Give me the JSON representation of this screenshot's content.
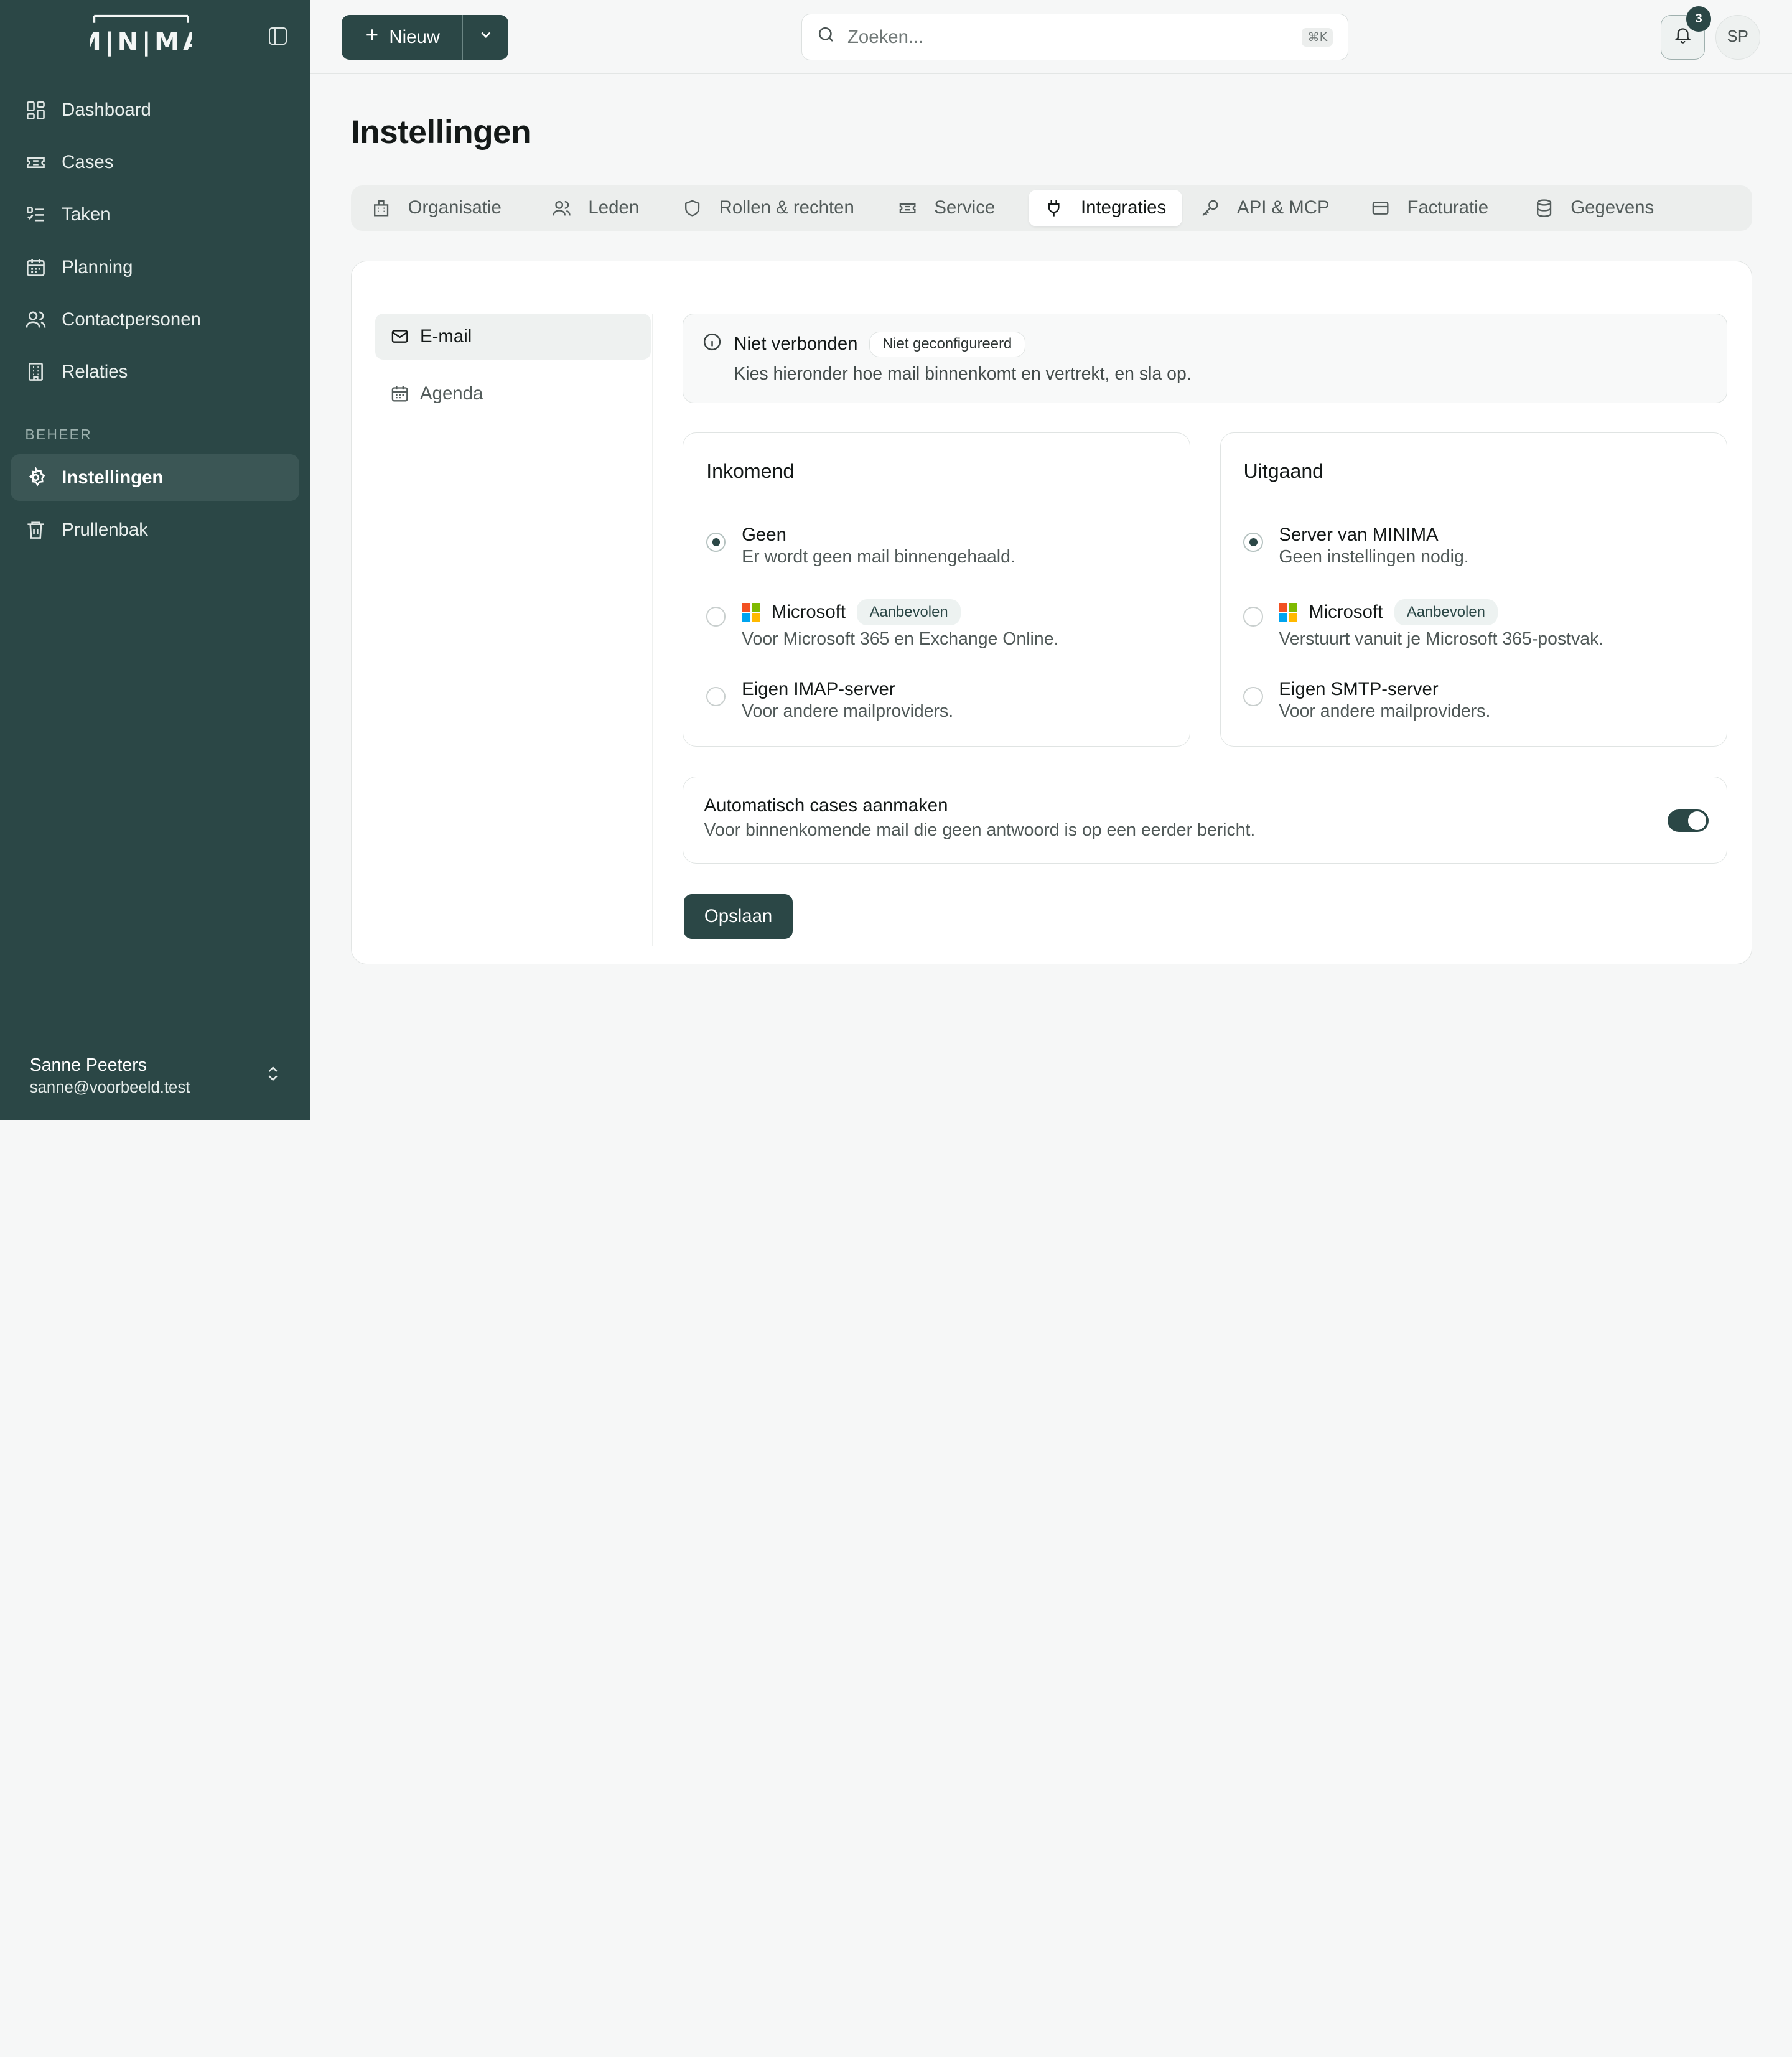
{
  "app": {
    "logo_text": "MINIMA"
  },
  "sidebar": {
    "items": [
      {
        "label": "Dashboard",
        "icon": "dashboard-icon"
      },
      {
        "label": "Cases",
        "icon": "ticket-icon"
      },
      {
        "label": "Taken",
        "icon": "checklist-icon"
      },
      {
        "label": "Planning",
        "icon": "calendar-icon"
      },
      {
        "label": "Contactpersonen",
        "icon": "users-icon"
      },
      {
        "label": "Relaties",
        "icon": "building-icon"
      }
    ],
    "section_label": "BEHEER",
    "admin_items": [
      {
        "label": "Instellingen",
        "icon": "gear-icon",
        "active": true
      },
      {
        "label": "Prullenbak",
        "icon": "trash-icon"
      }
    ],
    "user": {
      "name": "Sanne Peeters",
      "email": "sanne@voorbeeld.test"
    }
  },
  "topbar": {
    "new_label": "Nieuw",
    "search_placeholder": "Zoeken...",
    "search_shortcut": "⌘K",
    "notification_count": "3",
    "avatar_initials": "SP"
  },
  "page": {
    "title": "Instellingen"
  },
  "tabs": [
    {
      "label": "Organisatie",
      "icon": "building-icon"
    },
    {
      "label": "Leden",
      "icon": "users-icon"
    },
    {
      "label": "Rollen & rechten",
      "icon": "shield-icon"
    },
    {
      "label": "Service",
      "icon": "ticket-icon"
    },
    {
      "label": "Integraties",
      "icon": "plug-icon",
      "active": true
    },
    {
      "label": "API & MCP",
      "icon": "key-icon"
    },
    {
      "label": "Facturatie",
      "icon": "credit-card-icon"
    },
    {
      "label": "Gegevens",
      "icon": "database-icon"
    }
  ],
  "subnav": [
    {
      "label": "E-mail",
      "icon": "mail-icon",
      "active": true
    },
    {
      "label": "Agenda",
      "icon": "calendar-icon"
    }
  ],
  "status": {
    "title": "Niet verbonden",
    "pill": "Niet geconfigureerd",
    "subtitle": "Kies hieronder hoe mail binnenkomt en vertrekt, en sla op."
  },
  "incoming": {
    "title": "Inkomend",
    "options": [
      {
        "title": "Geen",
        "desc": "Er wordt geen mail binnengehaald.",
        "selected": true
      },
      {
        "title": "Microsoft",
        "badge": "Aanbevolen",
        "desc": "Voor Microsoft 365 en Exchange Online."
      },
      {
        "title": "Eigen IMAP-server",
        "desc": "Voor andere mailproviders."
      }
    ]
  },
  "outgoing": {
    "title": "Uitgaand",
    "options": [
      {
        "title": "Server van MINIMA",
        "desc": "Geen instellingen nodig.",
        "selected": true
      },
      {
        "title": "Microsoft",
        "badge": "Aanbevolen",
        "desc": "Verstuurt vanuit je Microsoft 365-postvak."
      },
      {
        "title": "Eigen SMTP-server",
        "desc": "Voor andere mailproviders."
      }
    ]
  },
  "auto_cases": {
    "title": "Automatisch cases aanmaken",
    "desc": "Voor binnenkomende mail die geen antwoord is op een eerder bericht.",
    "enabled": true
  },
  "save_label": "Opslaan",
  "colors": {
    "brand": "#2b4746",
    "background": "#f6f7f7"
  }
}
